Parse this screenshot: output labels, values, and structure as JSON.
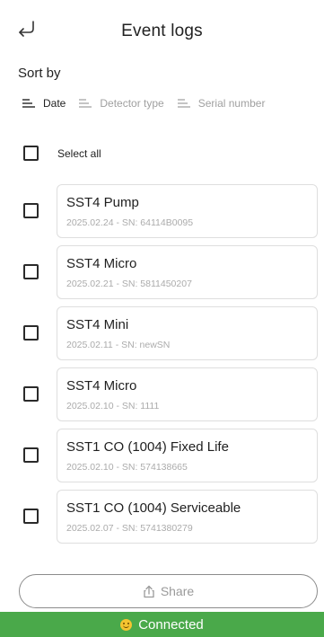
{
  "header": {
    "title": "Event logs"
  },
  "sort": {
    "label": "Sort by",
    "options": [
      {
        "label": "Date",
        "active": true
      },
      {
        "label": "Detector type",
        "active": false
      },
      {
        "label": "Serial number",
        "active": false
      }
    ]
  },
  "select_all": {
    "label": "Select all"
  },
  "logs": [
    {
      "title": "SST4 Pump",
      "subtitle": "2025.02.24 - SN: 64114B0095"
    },
    {
      "title": "SST4 Micro",
      "subtitle": "2025.02.21 - SN: 5811450207"
    },
    {
      "title": "SST4 Mini",
      "subtitle": "2025.02.11 - SN: newSN"
    },
    {
      "title": "SST4 Micro",
      "subtitle": "2025.02.10 - SN: 1111"
    },
    {
      "title": "SST1 CO (1004) Fixed Life",
      "subtitle": "2025.02.10 - SN: 574138665"
    },
    {
      "title": "SST1 CO (1004) Serviceable",
      "subtitle": "2025.02.07 - SN: 5741380279"
    }
  ],
  "share": {
    "label": "Share"
  },
  "status": {
    "text": "Connected",
    "icon": "smiley-icon",
    "color": "#4aa94a"
  }
}
